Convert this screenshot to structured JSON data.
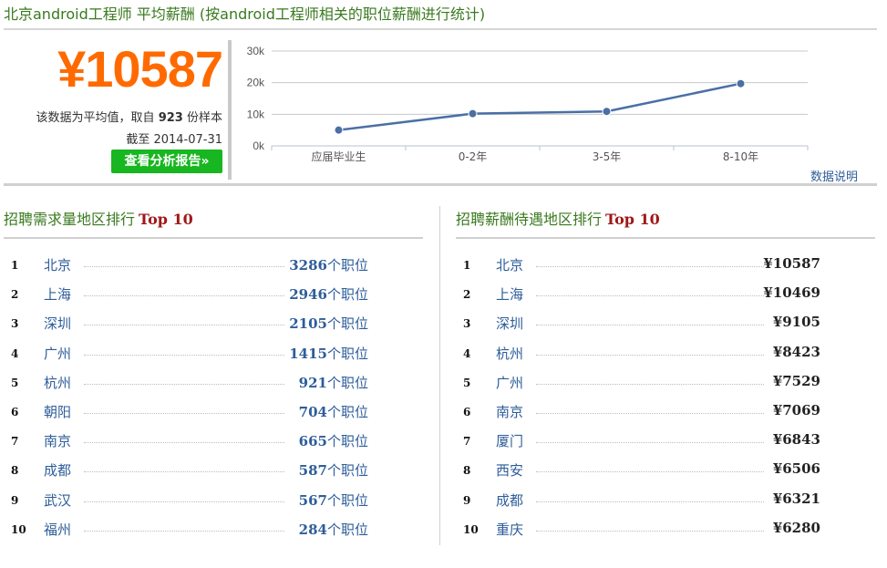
{
  "header": {
    "title": "北京android工程师 平均薪酬 (按android工程师相关的职位薪酬进行统计)"
  },
  "summary": {
    "avg_salary": "¥10587",
    "sample_prefix": "该数据为平均值，取自",
    "sample_count": "923",
    "sample_suffix": "份样本",
    "date_label": "截至 2014-07-31",
    "report_button": "查看分析报告»",
    "data_note": "数据说明"
  },
  "chart_data": {
    "type": "line",
    "categories": [
      "应届毕业生",
      "0-2年",
      "3-5年",
      "8-10年"
    ],
    "values": [
      5000,
      10200,
      10900,
      19700
    ],
    "yticks": [
      "0k",
      "10k",
      "20k",
      "30k"
    ],
    "ylim": [
      0,
      30000
    ],
    "grid": true,
    "color": "#4a6fa5"
  },
  "demand_ranking": {
    "title": "招聘需求量地区排行",
    "badge": "Top 10",
    "unit": "个职位",
    "rows": [
      {
        "rank": "1",
        "city": "北京",
        "count": "3286"
      },
      {
        "rank": "2",
        "city": "上海",
        "count": "2946"
      },
      {
        "rank": "3",
        "city": "深圳",
        "count": "2105"
      },
      {
        "rank": "4",
        "city": "广州",
        "count": "1415"
      },
      {
        "rank": "5",
        "city": "杭州",
        "count": "921"
      },
      {
        "rank": "6",
        "city": "朝阳",
        "count": "704"
      },
      {
        "rank": "7",
        "city": "南京",
        "count": "665"
      },
      {
        "rank": "8",
        "city": "成都",
        "count": "587"
      },
      {
        "rank": "9",
        "city": "武汉",
        "count": "567"
      },
      {
        "rank": "10",
        "city": "福州",
        "count": "284"
      }
    ]
  },
  "salary_ranking": {
    "title": "招聘薪酬待遇地区排行",
    "badge": "Top 10",
    "rows": [
      {
        "rank": "1",
        "city": "北京",
        "salary": "¥10587"
      },
      {
        "rank": "2",
        "city": "上海",
        "salary": "¥10469"
      },
      {
        "rank": "3",
        "city": "深圳",
        "salary": "¥9105"
      },
      {
        "rank": "4",
        "city": "杭州",
        "salary": "¥8423"
      },
      {
        "rank": "5",
        "city": "广州",
        "salary": "¥7529"
      },
      {
        "rank": "6",
        "city": "南京",
        "salary": "¥7069"
      },
      {
        "rank": "7",
        "city": "厦门",
        "salary": "¥6843"
      },
      {
        "rank": "8",
        "city": "西安",
        "salary": "¥6506"
      },
      {
        "rank": "9",
        "city": "成都",
        "salary": "¥6321"
      },
      {
        "rank": "10",
        "city": "重庆",
        "salary": "¥6280"
      }
    ]
  }
}
